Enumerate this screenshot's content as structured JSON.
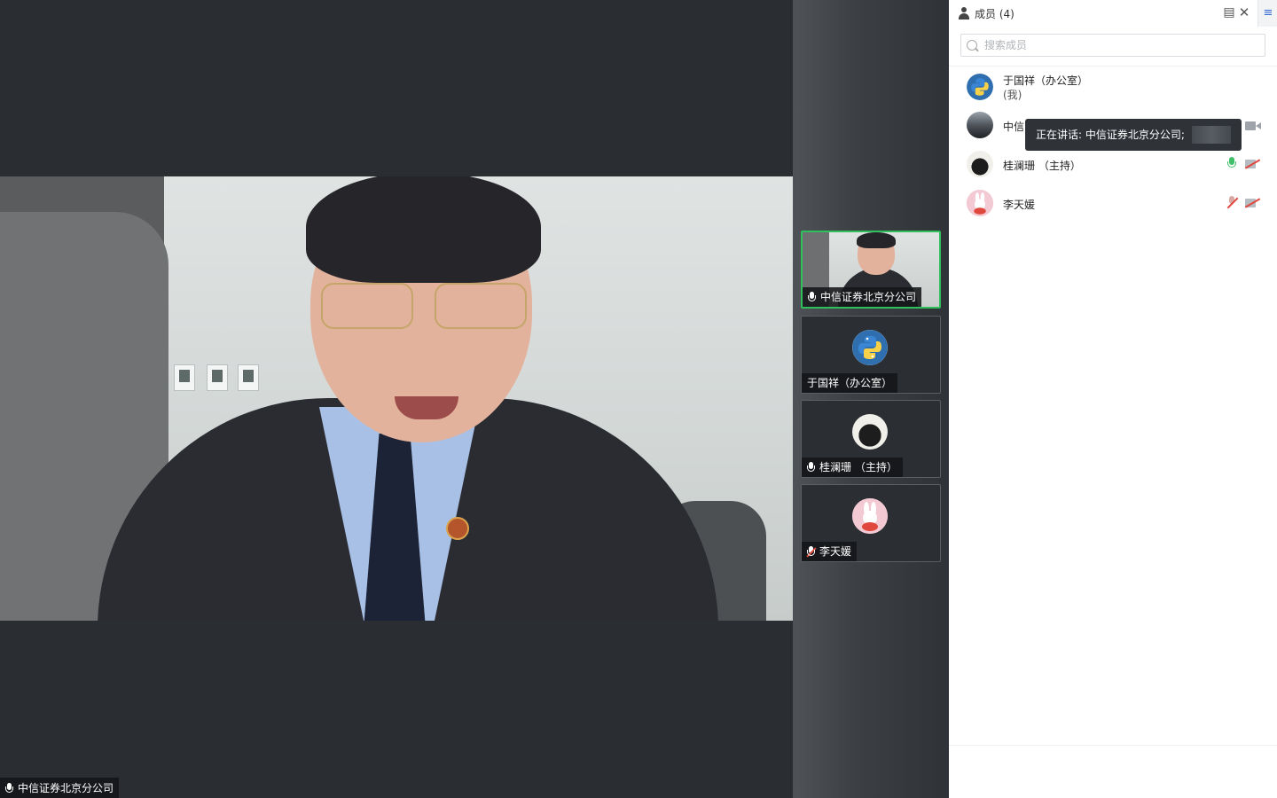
{
  "main_video": {
    "speaker_name": "中信证券北京分公司"
  },
  "gallery": {
    "tiles": [
      {
        "name": "中信证券北京分公司",
        "mic": "on",
        "active": true
      },
      {
        "name": "于国祥（办公室）",
        "mic": "none",
        "active": false
      },
      {
        "name": "桂澜珊 （主持）",
        "mic": "on",
        "active": false
      },
      {
        "name": "李天媛",
        "mic": "muted",
        "active": false
      }
    ]
  },
  "panel": {
    "title": "成员 (4)",
    "pin_icon": "pin-icon",
    "close_icon": "close-icon",
    "menu_icon": "menu-icon",
    "search_placeholder": "搜索成员",
    "members": [
      {
        "name": "于国祥（办公室）",
        "sub": "(我)"
      },
      {
        "name": "中信"
      },
      {
        "name": "桂澜珊 （主持）",
        "mic": "on",
        "cam": "off"
      },
      {
        "name": "李天媛",
        "mic": "muted",
        "cam": "off"
      }
    ],
    "tooltip": "正在讲话: 中信证券北京分公司;"
  },
  "colors": {
    "active_border": "#2fbf5b",
    "mic_on": "#3fbf6a",
    "muted": "#e0483e"
  }
}
